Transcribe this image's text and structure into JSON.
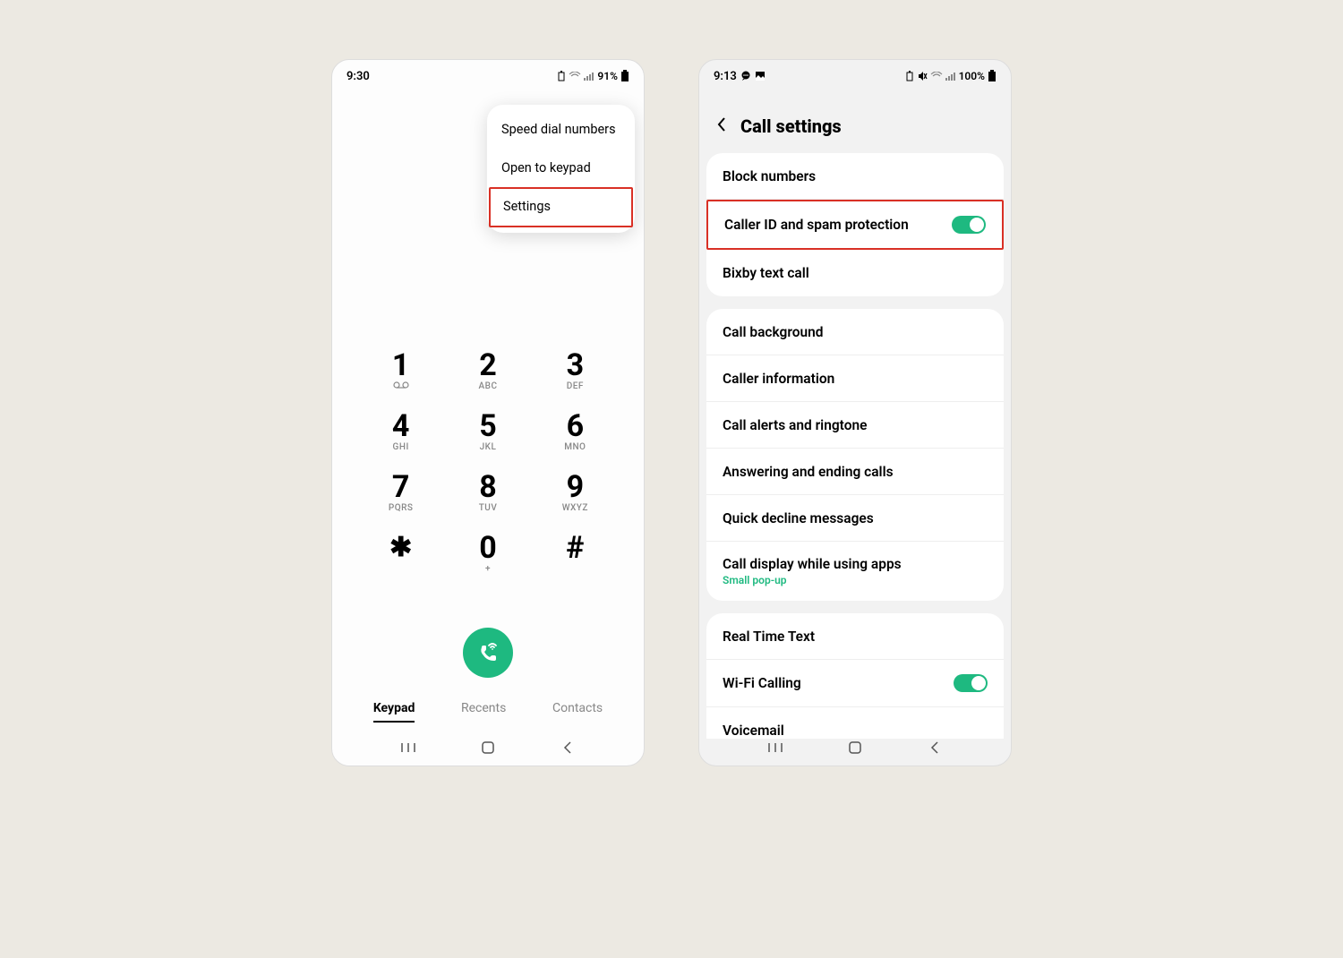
{
  "left": {
    "time": "9:30",
    "battery": "91%",
    "menu": {
      "item1": "Speed dial numbers",
      "item2": "Open to keypad",
      "item3": "Settings"
    },
    "keypad": {
      "k1": {
        "digit": "1",
        "letters": ""
      },
      "k2": {
        "digit": "2",
        "letters": "ABC"
      },
      "k3": {
        "digit": "3",
        "letters": "DEF"
      },
      "k4": {
        "digit": "4",
        "letters": "GHI"
      },
      "k5": {
        "digit": "5",
        "letters": "JKL"
      },
      "k6": {
        "digit": "6",
        "letters": "MNO"
      },
      "k7": {
        "digit": "7",
        "letters": "PQRS"
      },
      "k8": {
        "digit": "8",
        "letters": "TUV"
      },
      "k9": {
        "digit": "9",
        "letters": "WXYZ"
      },
      "kstar": {
        "digit": "✱",
        "letters": ""
      },
      "k0": {
        "digit": "0",
        "letters": "+"
      },
      "khash": {
        "digit": "#",
        "letters": ""
      }
    },
    "voicemail_glyph": "⌕⌕",
    "tabs": {
      "keypad": "Keypad",
      "recents": "Recents",
      "contacts": "Contacts"
    }
  },
  "right": {
    "time": "9:13",
    "battery": "100%",
    "title": "Call settings",
    "section1": {
      "block": "Block numbers",
      "caller_id": "Caller ID and spam protection",
      "bixby": "Bixby text call"
    },
    "section2": {
      "background": "Call background",
      "caller_info": "Caller information",
      "alerts": "Call alerts and ringtone",
      "answering": "Answering and ending calls",
      "decline": "Quick decline messages",
      "display": "Call display while using apps",
      "display_sub": "Small pop-up"
    },
    "section3": {
      "rtt": "Real Time Text",
      "wifi": "Wi-Fi Calling",
      "voicemail": "Voicemail"
    }
  }
}
